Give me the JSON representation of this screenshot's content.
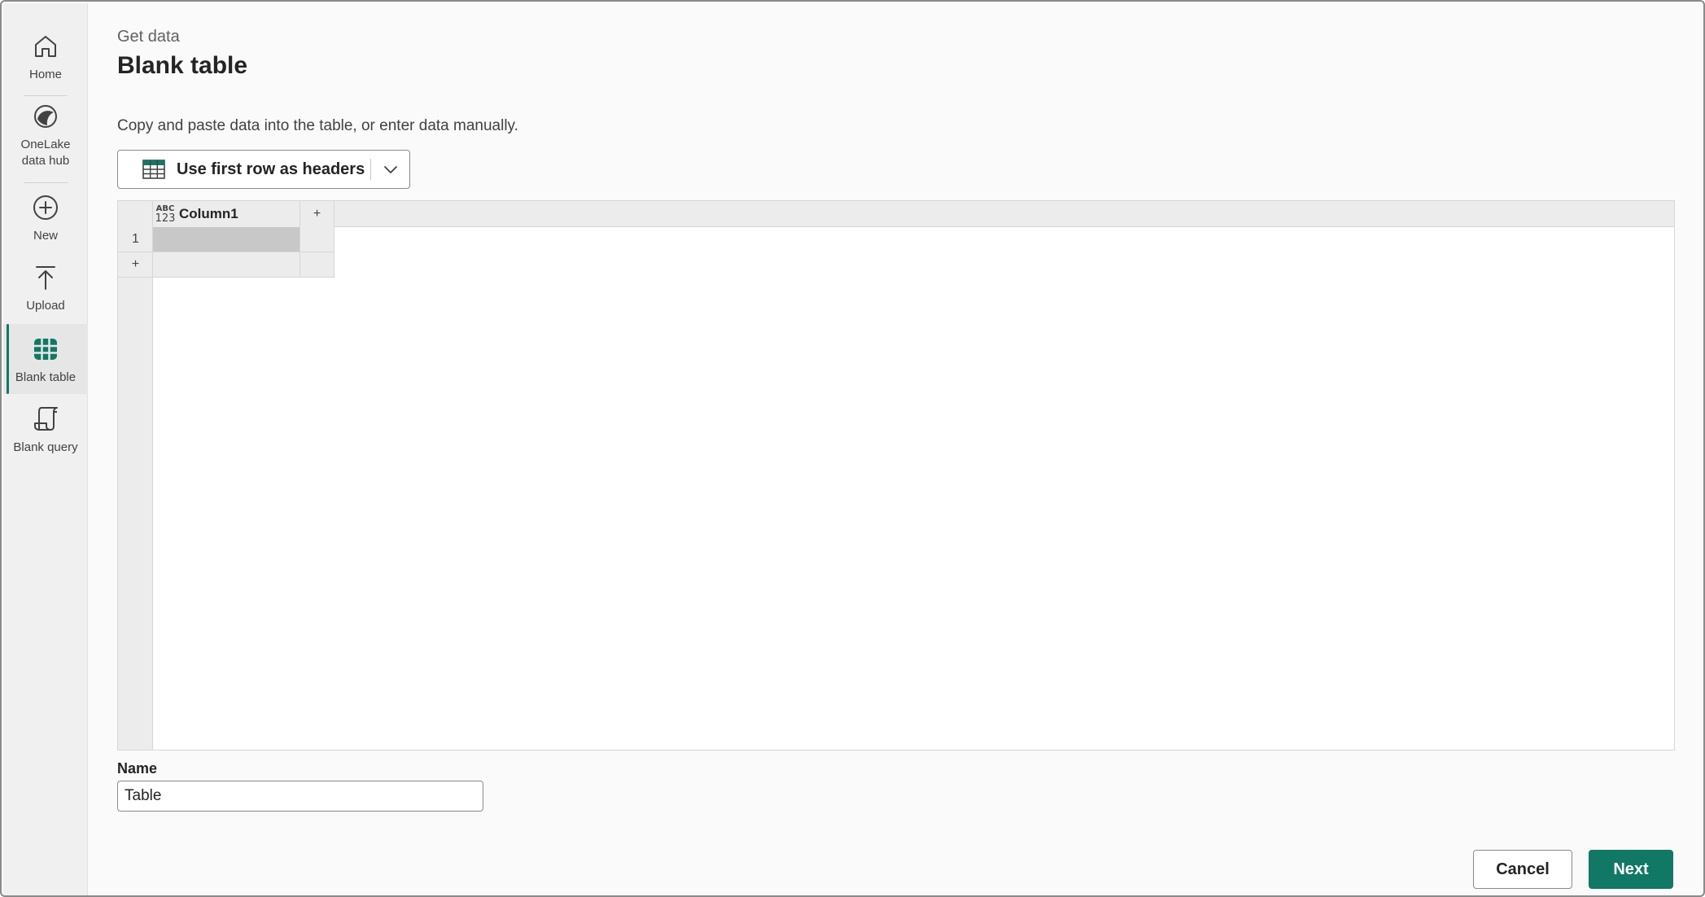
{
  "sidebar": {
    "items": [
      {
        "label": "Home",
        "icon": "home-icon"
      },
      {
        "label": "OneLake\ndata hub",
        "icon": "onelake-icon"
      },
      {
        "label": "New",
        "icon": "plus-circle-icon"
      },
      {
        "label": "Upload",
        "icon": "upload-icon"
      },
      {
        "label": "Blank table",
        "icon": "table-icon",
        "active": true
      },
      {
        "label": "Blank query",
        "icon": "script-icon"
      }
    ]
  },
  "header": {
    "breadcrumb": "Get data",
    "title": "Blank table"
  },
  "instructions": "Copy and paste data into the table, or enter data manually.",
  "headers_button": {
    "label": "Use first row as headers"
  },
  "grid": {
    "type_icon_top": "ABC",
    "type_icon_bottom": "123",
    "columns": [
      "Column1"
    ],
    "add_column_symbol": "+",
    "rows": [
      {
        "number": "1",
        "values": [
          ""
        ]
      }
    ],
    "add_row_symbol": "+"
  },
  "name": {
    "label": "Name",
    "value": "Table"
  },
  "footer": {
    "cancel_label": "Cancel",
    "next_label": "Next"
  },
  "colors": {
    "accent": "#117865",
    "sidebar_bg": "#f0f0f0",
    "grid_header_bg": "#ececec",
    "selected_cell": "#c8c8c8"
  }
}
